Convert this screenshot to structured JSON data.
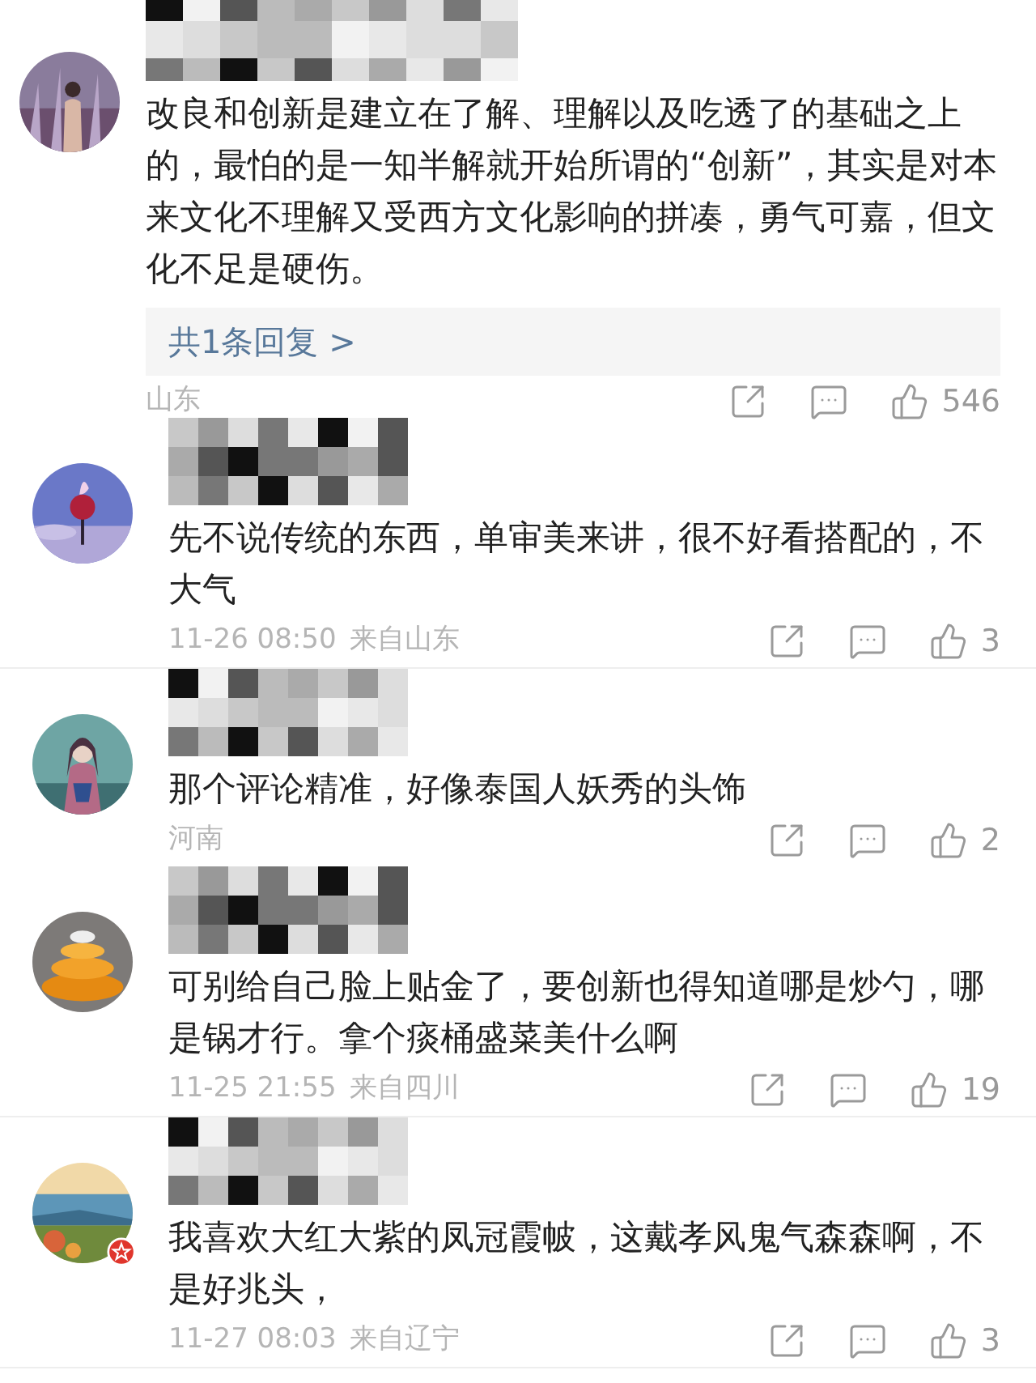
{
  "comments": [
    {
      "verified": false,
      "text": "改良和创新是建立在了解、理解以及吃透了的基础之上的，最怕的是一知半解就开始所谓的“创新”，其实是对本来文化不理解又受西方文化影响的拼凑，勇气可嘉，但文化不足是硬伤。",
      "reply_link": "共1条回复 >",
      "meta": {
        "location": "山东",
        "likes": "546"
      }
    },
    {
      "verified": false,
      "text": "先不说传统的东西，单审美来讲，很不好看搭配的，不大气",
      "meta": {
        "time": "11-26 08:50",
        "location": "来自山东",
        "likes": "3"
      }
    },
    {
      "verified": false,
      "text": "那个评论精准，好像泰国人妖秀的头饰",
      "meta": {
        "location": "河南",
        "likes": "2"
      }
    },
    {
      "verified": false,
      "text": "可别给自己脸上贴金了，要创新也得知道哪是炒勺，哪是锅才行。拿个痰桶盛菜美什么啊",
      "meta": {
        "time": "11-25 21:55",
        "location": "来自四川",
        "likes": "19"
      }
    },
    {
      "verified": true,
      "text": "我喜欢大红大紫的凤冠霞帔，这戴孝风鬼气森森啊，不是好兆头，",
      "meta": {
        "time": "11-27 08:03",
        "location": "来自辽宁",
        "likes": "3"
      }
    }
  ]
}
